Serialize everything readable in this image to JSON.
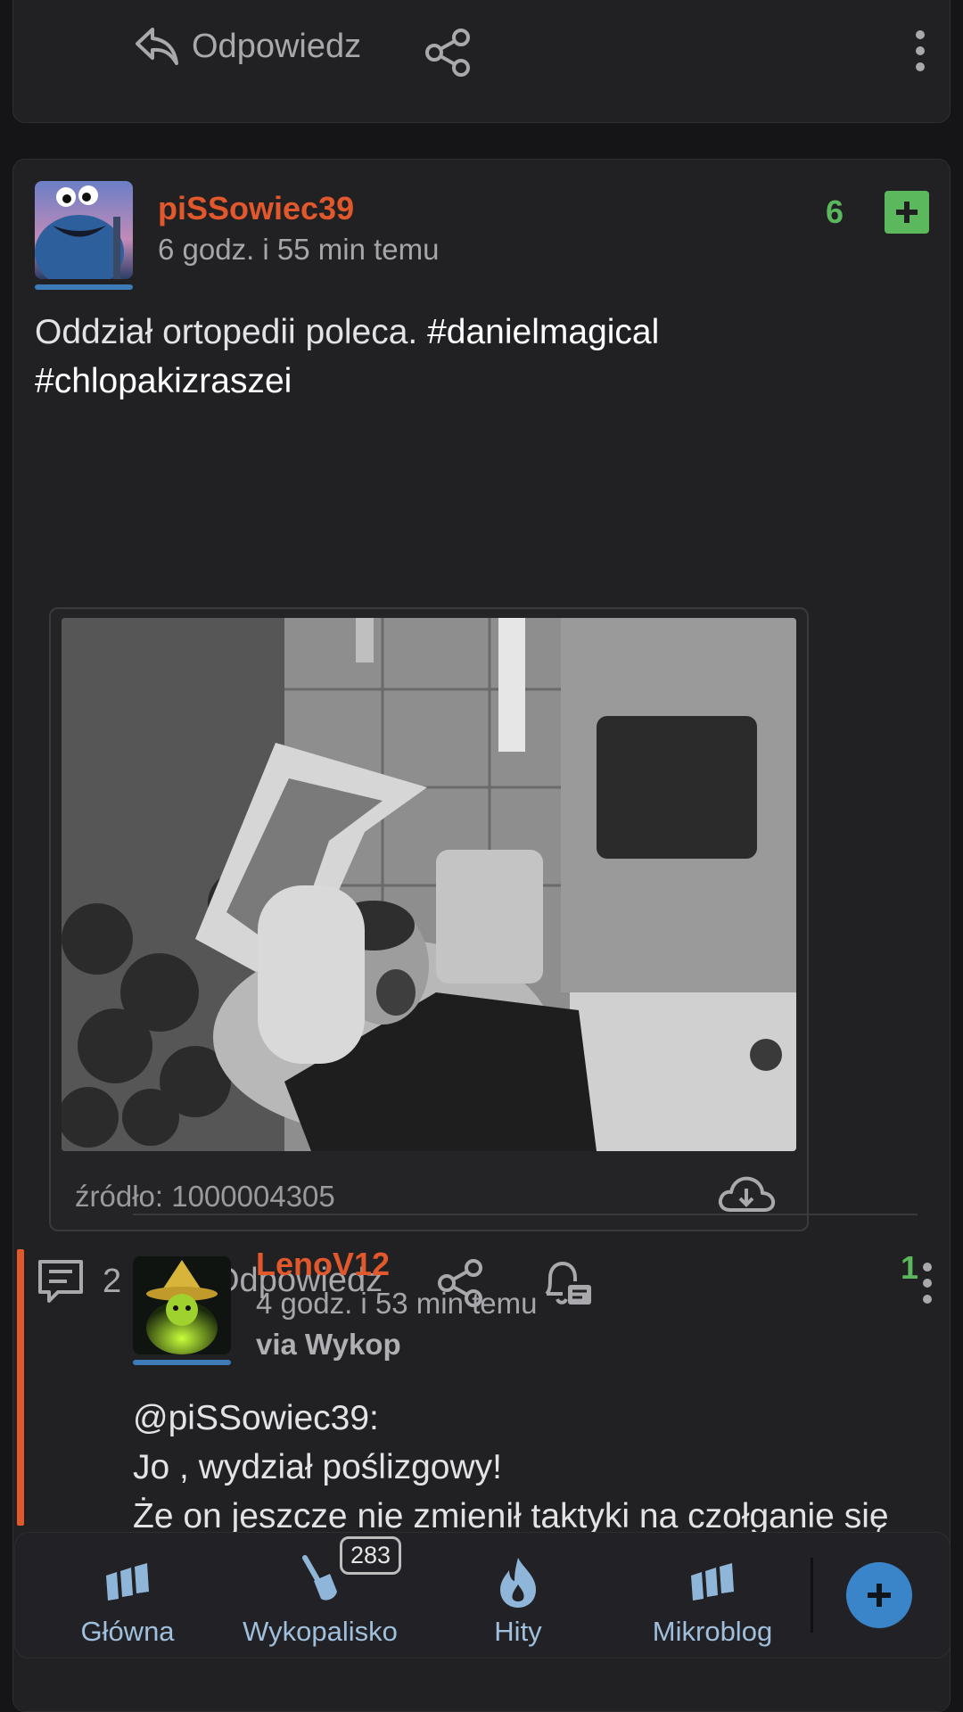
{
  "top_card": {
    "reply_label": "Odpowiedz"
  },
  "entry": {
    "username": "piSSowiec39",
    "time": "6 godz. i 55 min temu",
    "score": "6",
    "text_plain": "Oddział ortopedii poleca. ",
    "tag1": "#danielmagical",
    "tag2": "#chlopakizraszei",
    "embed": {
      "source": "źródło: 1000004305"
    },
    "actions": {
      "comments_count": "2",
      "reply_label": "Odpowiedz"
    }
  },
  "comment": {
    "username": "LenoV12",
    "time": "4 godz. i 53 min temu",
    "via": "via Wykop",
    "score": "1",
    "line1": "@piSSowiec39:",
    "line2": "Jo , wydział poślizgowy!",
    "line3": "Że on jeszcze nie zmienił taktyki na czołganie się"
  },
  "bottom_nav": {
    "items": [
      {
        "label": "Główna",
        "icon": "home-logo-icon"
      },
      {
        "label": "Wykopalisko",
        "icon": "shovel-icon",
        "badge": "283"
      },
      {
        "label": "Hity",
        "icon": "flame-icon"
      },
      {
        "label": "Mikroblog",
        "icon": "mikroblog-logo-icon"
      }
    ],
    "add_label": "+"
  },
  "colors": {
    "accent_blue": "#3a85c9",
    "username_orange": "#e0582c",
    "score_green": "#5cb85c",
    "background": "#151517",
    "card": "#212124"
  }
}
